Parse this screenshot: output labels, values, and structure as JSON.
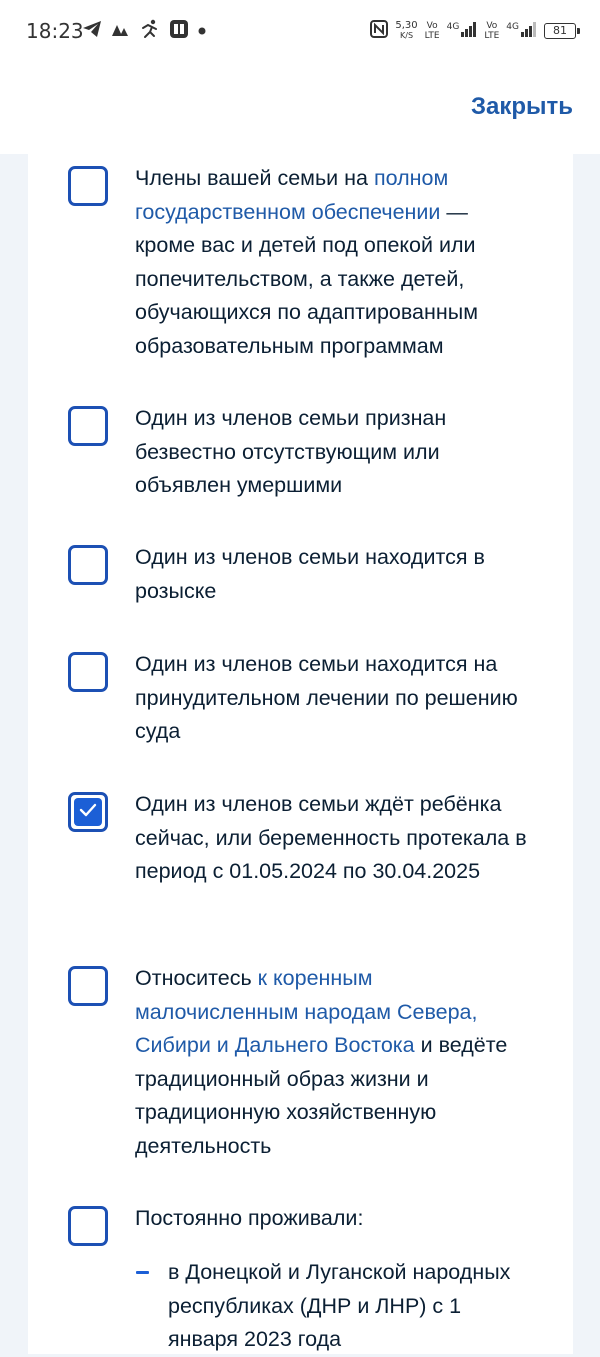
{
  "status_bar": {
    "time": "18:23",
    "net_speed_value": "5,30",
    "net_speed_unit": "K/S",
    "volte_1_top": "Vo",
    "volte_1_bottom": "LTE",
    "network_1_label": "4G",
    "volte_2_top": "Vo",
    "volte_2_bottom": "LTE",
    "network_2_label": "4G",
    "battery_level": "81"
  },
  "header": {
    "close_label": "Закрыть"
  },
  "options": [
    {
      "text_before": "Члены вашей семьи на ",
      "link": "полном государственном обеспечении",
      "text_after": " — кроме вас и детей под опекой или попечительством, а также детей, обучающихся по адаптированным образовательным программам",
      "checked": false
    },
    {
      "text": "Один из членов семьи признан безвестно отсутствующим или объявлен умершими",
      "checked": false
    },
    {
      "text": "Один из членов семьи находится в розыске",
      "checked": false
    },
    {
      "text": "Один из членов семьи находится на принудительном лечении по решению суда",
      "checked": false
    },
    {
      "text": "Один из членов семьи ждёт ребёнка сейчас, или беременность протекала в период с 01.05.2024 по 30.04.2025",
      "checked": true
    },
    {
      "text_before": "Относитесь ",
      "link": "к коренным малочисленным народам Севера, Сибири и Дальнего Востока",
      "text_after": " и ведёте традиционный образ жизни и традиционную хозяйственную деятельность",
      "checked": false
    },
    {
      "text": "Постоянно проживали:",
      "checked": false,
      "sub_items": [
        "в Донецкой и Луганской народных республиках (ДНР и ЛНР) с 1 января 2023 года"
      ]
    }
  ]
}
